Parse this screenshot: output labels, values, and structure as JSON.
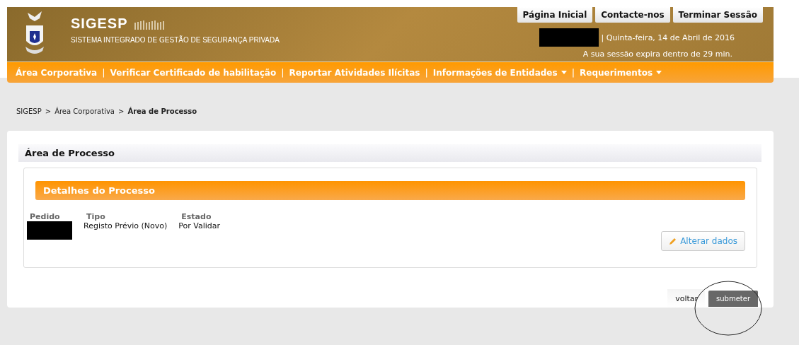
{
  "header": {
    "title": "SIGESP",
    "subtitle": "SISTEMA INTEGRADO DE GESTÃO DE SEGURANÇA PRIVADA",
    "top_links": [
      "Página Inicial",
      "Contacte-nos",
      "Terminar Sessão"
    ],
    "date": "| Quinta-feira, 14 de Abril de 2016",
    "session": "A sua sessão expira dentro de 29 min."
  },
  "nav": [
    {
      "label": "Área Corporativa",
      "dropdown": false
    },
    {
      "label": "Verificar Certificado de habilitação",
      "dropdown": false
    },
    {
      "label": "Reportar Atividades Ilícitas",
      "dropdown": false
    },
    {
      "label": "Informações de Entidades",
      "dropdown": true
    },
    {
      "label": "Requerimentos",
      "dropdown": true
    }
  ],
  "breadcrumb": [
    {
      "label": "SIGESP",
      "current": false
    },
    {
      "label": "Área Corporativa",
      "current": false
    },
    {
      "label": "Área de Processo",
      "current": true
    }
  ],
  "breadcrumb_separator": ">",
  "nav_separator": "|",
  "card": {
    "title": "Área de Processo",
    "section_title": "Detalhes do Processo",
    "fields": [
      {
        "label": "Pedido",
        "redacted": true
      },
      {
        "label": "Tipo",
        "value": "Registo Prévio (Novo)"
      },
      {
        "label": "Estado",
        "value": "Por Validar"
      }
    ],
    "edit_button": "Alterar dados",
    "back_button": "voltar",
    "submit_button": "submeter",
    "submit_circled": true
  }
}
